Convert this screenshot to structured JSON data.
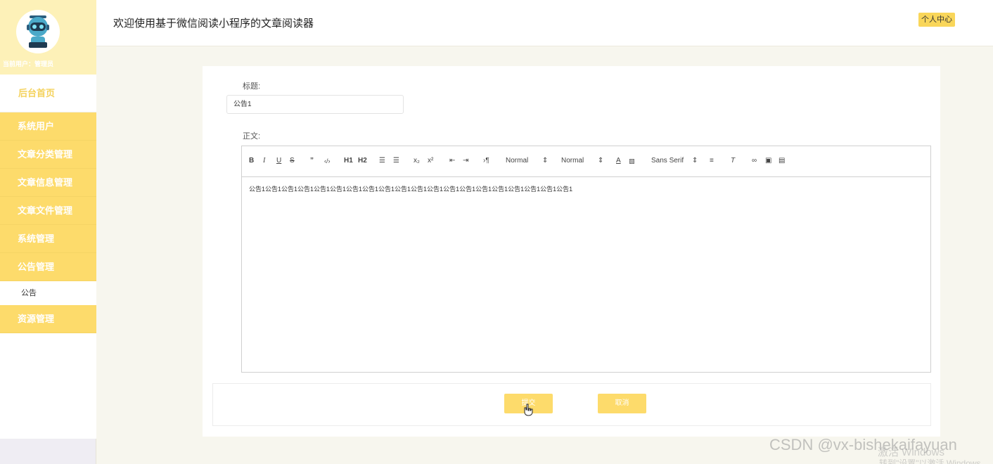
{
  "sidebar": {
    "user_line": "当前用户：管理员",
    "home": "后台首页",
    "items": [
      "系统用户",
      "文章分类管理",
      "文章信息管理",
      "文章文件管理",
      "系统管理",
      "公告管理"
    ],
    "sub_item": "公告",
    "last_item": "资源管理"
  },
  "header": {
    "title": "欢迎使用基于微信阅读小程序的文章阅读器",
    "personal": "个人中心"
  },
  "form": {
    "title_label": "标题:",
    "title_value": "公告1",
    "body_label": "正文:",
    "body_text": "公告1公告1公告1公告1公告1公告1公告1公告1公告1公告1公告1公告1公告1公告1公告1公告1公告1公告1公告1公告1"
  },
  "toolbar": {
    "h1": "H1",
    "h2": "H2",
    "size": "Normal",
    "header": "Normal",
    "font": "Sans Serif"
  },
  "buttons": {
    "submit": "提交",
    "cancel": "取消"
  },
  "watermarks": {
    "csdn": "CSDN @vx-bishekaifayuan",
    "win1": "激活 Windows",
    "win2": "转到\"设置\"以激活 Windows。"
  },
  "colors": {
    "accent": "#fddb6b",
    "sidebar_top": "#fdf1b8"
  }
}
